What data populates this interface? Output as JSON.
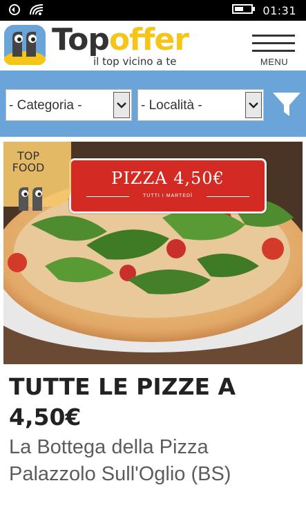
{
  "status_bar": {
    "time": "01:31",
    "icons": [
      "data-saver-icon",
      "wifi-icon",
      "battery-icon"
    ]
  },
  "header": {
    "brand_part1": "Top",
    "brand_part2": "offer",
    "tagline": "il top vicino a te",
    "menu_label": "MENU",
    "brand_colors": {
      "dark": "#333333",
      "accent": "#f5c518"
    }
  },
  "filters": {
    "category": {
      "selected": "- Categoria -"
    },
    "location": {
      "selected": "- Località -"
    },
    "background": "#6aa4d8"
  },
  "hero": {
    "badge_line1": "TOP",
    "badge_line2": "FOOD",
    "promo_title": "PIZZA 4,50€",
    "promo_sub": "TUTTI I MARTEDÌ"
  },
  "offer": {
    "title": "TUTTE LE PIZZE A 4,50€",
    "place": "La Bottega della Pizza Palazzolo Sull'Oglio (BS)"
  }
}
